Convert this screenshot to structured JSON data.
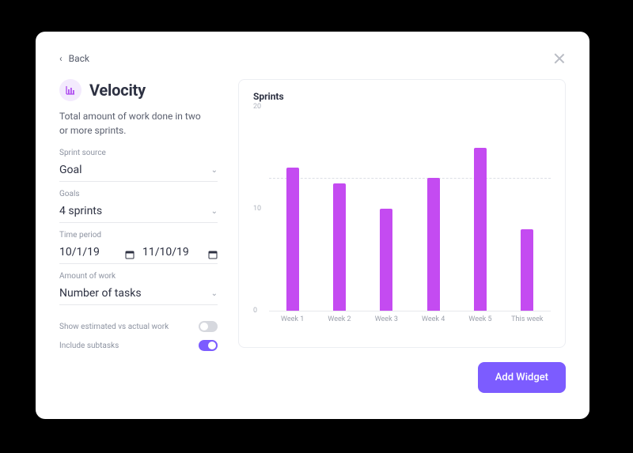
{
  "nav": {
    "back_label": "Back"
  },
  "header": {
    "title": "Velocity",
    "description": "Total amount of work done in two or more sprints."
  },
  "fields": {
    "sprint_source": {
      "label": "Sprint source",
      "value": "Goal"
    },
    "goals": {
      "label": "Goals",
      "value": "4 sprints"
    },
    "time_period": {
      "label": "Time period",
      "from": "10/1/19",
      "to": "11/10/19"
    },
    "amount_of_work": {
      "label": "Amount of work",
      "value": "Number of tasks"
    }
  },
  "toggles": {
    "estimated_vs_actual": {
      "label": "Show estimated vs actual work",
      "on": false
    },
    "include_subtasks": {
      "label": "Include subtasks",
      "on": true
    }
  },
  "buttons": {
    "add_widget": "Add Widget"
  },
  "chart_data": {
    "type": "bar",
    "title": "Sprints",
    "ylabel": "",
    "xlabel": "",
    "ylim": [
      0,
      20
    ],
    "yticks": [
      0,
      10,
      20
    ],
    "reference_line": 13,
    "categories": [
      "Week 1",
      "Week 2",
      "Week 3",
      "Week 4",
      "Week 5",
      "This week"
    ],
    "values": [
      14,
      12.5,
      10,
      13,
      16,
      8
    ]
  },
  "colors": {
    "accent": "#7c5cff",
    "bar": "#c44bf1"
  }
}
